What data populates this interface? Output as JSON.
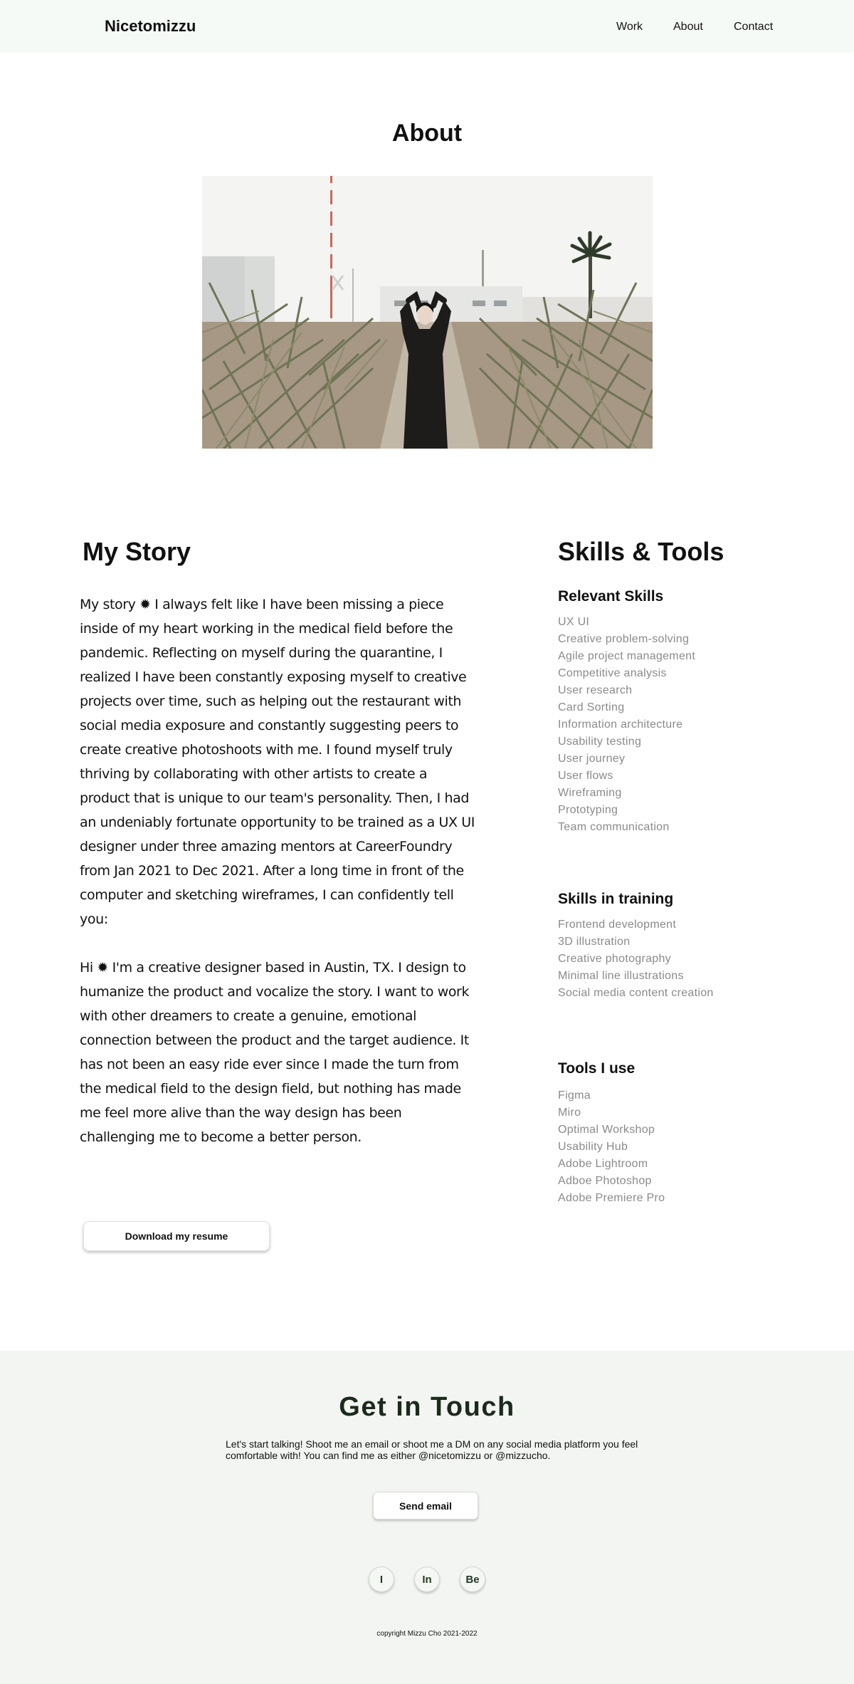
{
  "nav": {
    "brand": "Nicetomizzu",
    "links": [
      "Work",
      "About",
      "Contact"
    ]
  },
  "about": {
    "title": "About"
  },
  "story": {
    "title": "My Story",
    "paragraphs": [
      "My story ✹ I always felt like I have been missing a piece inside of my heart working in the medical field before the pandemic. Reflecting on myself during the quarantine, I realized I have been constantly exposing myself to creative projects over time, such as helping out the restaurant with social media exposure and constantly suggesting peers to create creative photoshoots with me. I found myself truly thriving by collaborating with other artists to create a product that is unique to our team's personality. Then, I had an undeniably fortunate opportunity to be trained as a UX UI designer under three amazing mentors at CareerFoundry from Jan 2021 to Dec 2021. After a long time in front of the computer and sketching wireframes, I can confidently tell you:",
      "Hi ✹ I'm a creative designer based in Austin, TX. I design to humanize the product and vocalize the story. I want to work with other dreamers to create a genuine, emotional connection between the product and the target audience. It has not been an easy ride ever since I made the turn from the medical field to the design field, but nothing has made me feel more alive than the way design has been challenging me to become a better person."
    ],
    "resume_button": "Download my resume"
  },
  "skills": {
    "title": "Skills & Tools",
    "relevant": {
      "heading": "Relevant Skills",
      "items": [
        "UX UI",
        "Creative problem-solving",
        "Agile project management",
        "Competitive analysis",
        "User research",
        "Card Sorting",
        "Information architecture",
        "Usability testing",
        "User journey",
        "User flows",
        "Wireframing",
        "Prototyping",
        "Team communication"
      ]
    },
    "training": {
      "heading": "Skills in training",
      "items": [
        "Frontend development",
        "3D illustration",
        "Creative photography",
        "Minimal line illustrations",
        "Social media content creation"
      ]
    },
    "tools": {
      "heading": "Tools I use",
      "items": [
        "Figma",
        "Miro",
        "Optimal Workshop",
        "Usability Hub",
        "Adobe Lightroom",
        "Adboe Photoshop",
        "Adobe Premiere Pro"
      ]
    }
  },
  "contact": {
    "title": "Get in Touch",
    "text": "Let's start talking! Shoot me an email or shoot me a DM on any social media platform you feel comfortable with! You can find me as either @nicetomizzu or @mizzucho.",
    "send_button": "Send email",
    "social": [
      "I",
      "In",
      "Be"
    ],
    "copyright": "copyright Mizzu Cho 2021-2022"
  }
}
